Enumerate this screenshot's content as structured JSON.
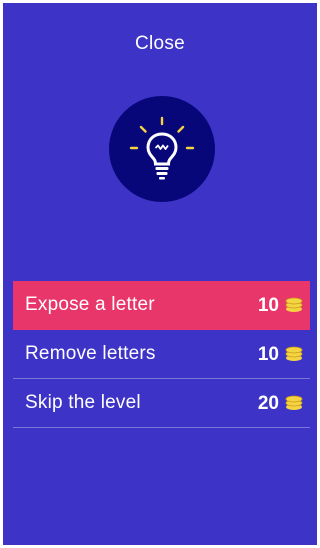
{
  "header": {
    "close_label": "Close"
  },
  "hint_icon": {
    "name": "lightbulb-icon",
    "background": "#07077a",
    "glyph_color": "#ffffff",
    "ray_color": "#f5d442"
  },
  "options": [
    {
      "label": "Expose a letter",
      "cost": "10",
      "selected": true
    },
    {
      "label": "Remove letters",
      "cost": "10",
      "selected": false
    },
    {
      "label": "Skip the level",
      "cost": "20",
      "selected": false
    }
  ],
  "colors": {
    "background": "#3d33c7",
    "selected_row": "#e8366b",
    "coin": "#f5d442"
  }
}
